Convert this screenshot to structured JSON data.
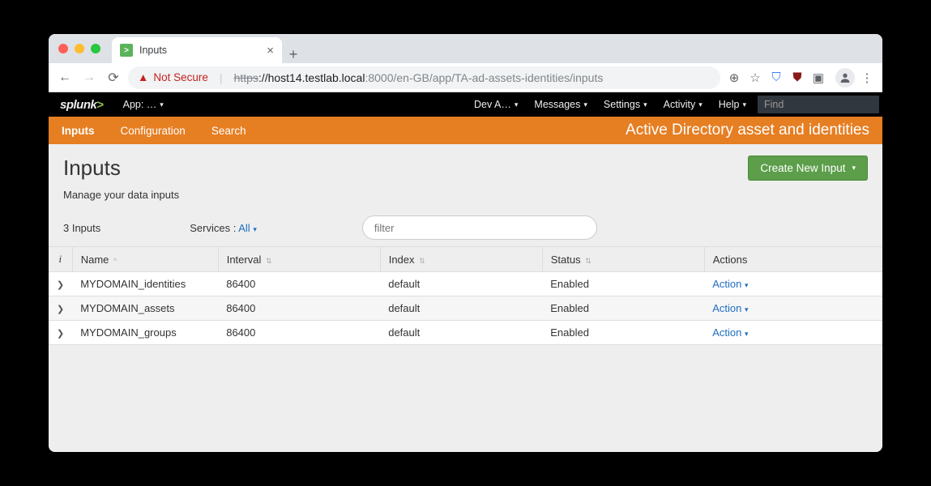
{
  "browser": {
    "tab_title": "Inputs",
    "not_secure": "Not Secure",
    "url_scheme": "https",
    "url_host": "://host14.testlab.local",
    "url_port_path": ":8000/en-GB/app/TA-ad-assets-identities/inputs"
  },
  "topbar": {
    "app_label": "App: …",
    "dev": "Dev A…",
    "messages": "Messages",
    "settings": "Settings",
    "activity": "Activity",
    "help": "Help",
    "find_placeholder": "Find"
  },
  "navbar": {
    "inputs": "Inputs",
    "configuration": "Configuration",
    "search": "Search",
    "app_title": "Active Directory asset and identities"
  },
  "page": {
    "title": "Inputs",
    "subtitle": "Manage your data inputs",
    "create_btn": "Create New Input",
    "count_label": "3 Inputs",
    "services_label": "Services :",
    "services_value": "All",
    "filter_placeholder": "filter"
  },
  "table": {
    "headers": {
      "name": "Name",
      "interval": "Interval",
      "index": "Index",
      "status": "Status",
      "actions": "Actions"
    },
    "rows": [
      {
        "name": "MYDOMAIN_identities",
        "interval": "86400",
        "index": "default",
        "status": "Enabled",
        "action": "Action"
      },
      {
        "name": "MYDOMAIN_assets",
        "interval": "86400",
        "index": "default",
        "status": "Enabled",
        "action": "Action"
      },
      {
        "name": "MYDOMAIN_groups",
        "interval": "86400",
        "index": "default",
        "status": "Enabled",
        "action": "Action"
      }
    ]
  }
}
